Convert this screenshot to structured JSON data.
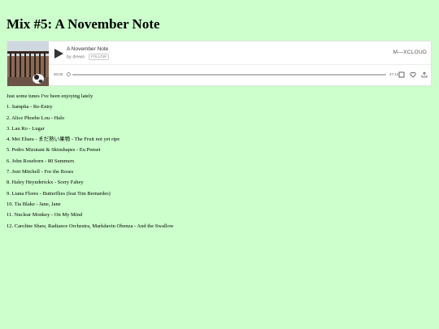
{
  "page": {
    "title": "Mix #5: A November Note"
  },
  "player": {
    "track_title": "A November Note",
    "by_prefix": "by",
    "artist": "drewn",
    "follow_label": "FOLLOW",
    "brand": "M—XCLOUD",
    "time_start": "00:00",
    "time_end": "47:14",
    "progress": 0,
    "icons": [
      "play-icon",
      "add-to-playlist-icon",
      "heart-icon",
      "share-icon"
    ]
  },
  "intro": "Just some tunes I've been enjoying lately",
  "tracklist": [
    "1. Sampha - Re-Entry",
    "2. Alice Phoebe Lou - Halo",
    "3. Lau Ro - Lugar",
    "4. Mei Ehara - まだ熟い果物 - The Fruit not yet ripe",
    "5. Pedro Mizutani & Skinshapes - Eu Pensei",
    "6. John Roseborn - 80 Summers",
    "7. Joni Mitchell - For the Roses",
    "8. Haley Heynderickx - Sorry Fahey",
    "9. Liana Flores - Butterflies (feat Tim Bernardes)",
    "10. Tia Blake - Jane, Jane",
    "11. Nuclear Monkey - On My Mind",
    "12. Caroline Shaw, Radiance Orchestra, Markdavin Obenza - And the Swallow"
  ]
}
